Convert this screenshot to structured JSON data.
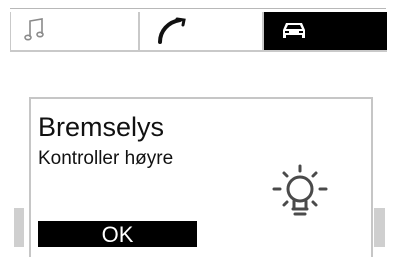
{
  "tabs": [
    {
      "icon": "music-note-icon",
      "active": false
    },
    {
      "icon": "phone-handset-icon",
      "active": false
    },
    {
      "icon": "car-icon",
      "active": true
    }
  ],
  "dialog": {
    "title": "Bremselys",
    "message": "Kontroller høyre",
    "icon": "light-bulb-icon",
    "ok_label": "OK"
  },
  "colors": {
    "background": "#ffffff",
    "active_tab": "#000000",
    "button": "#000000",
    "border": "#c6c6c6"
  }
}
